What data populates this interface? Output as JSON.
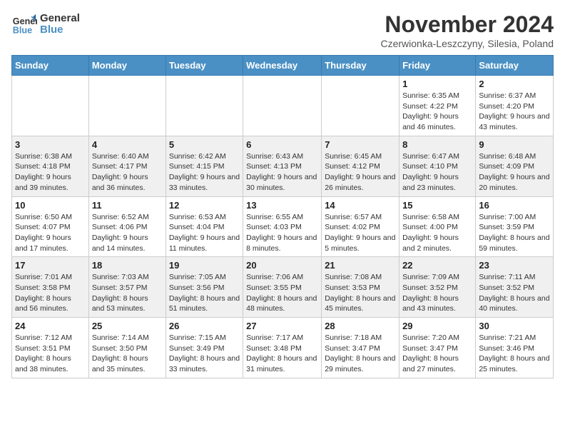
{
  "logo": {
    "line1": "General",
    "line2": "Blue"
  },
  "title": "November 2024",
  "subtitle": "Czerwionka-Leszczyny, Silesia, Poland",
  "days_of_week": [
    "Sunday",
    "Monday",
    "Tuesday",
    "Wednesday",
    "Thursday",
    "Friday",
    "Saturday"
  ],
  "weeks": [
    [
      {
        "day": "",
        "info": ""
      },
      {
        "day": "",
        "info": ""
      },
      {
        "day": "",
        "info": ""
      },
      {
        "day": "",
        "info": ""
      },
      {
        "day": "",
        "info": ""
      },
      {
        "day": "1",
        "info": "Sunrise: 6:35 AM\nSunset: 4:22 PM\nDaylight: 9 hours and 46 minutes."
      },
      {
        "day": "2",
        "info": "Sunrise: 6:37 AM\nSunset: 4:20 PM\nDaylight: 9 hours and 43 minutes."
      }
    ],
    [
      {
        "day": "3",
        "info": "Sunrise: 6:38 AM\nSunset: 4:18 PM\nDaylight: 9 hours and 39 minutes."
      },
      {
        "day": "4",
        "info": "Sunrise: 6:40 AM\nSunset: 4:17 PM\nDaylight: 9 hours and 36 minutes."
      },
      {
        "day": "5",
        "info": "Sunrise: 6:42 AM\nSunset: 4:15 PM\nDaylight: 9 hours and 33 minutes."
      },
      {
        "day": "6",
        "info": "Sunrise: 6:43 AM\nSunset: 4:13 PM\nDaylight: 9 hours and 30 minutes."
      },
      {
        "day": "7",
        "info": "Sunrise: 6:45 AM\nSunset: 4:12 PM\nDaylight: 9 hours and 26 minutes."
      },
      {
        "day": "8",
        "info": "Sunrise: 6:47 AM\nSunset: 4:10 PM\nDaylight: 9 hours and 23 minutes."
      },
      {
        "day": "9",
        "info": "Sunrise: 6:48 AM\nSunset: 4:09 PM\nDaylight: 9 hours and 20 minutes."
      }
    ],
    [
      {
        "day": "10",
        "info": "Sunrise: 6:50 AM\nSunset: 4:07 PM\nDaylight: 9 hours and 17 minutes."
      },
      {
        "day": "11",
        "info": "Sunrise: 6:52 AM\nSunset: 4:06 PM\nDaylight: 9 hours and 14 minutes."
      },
      {
        "day": "12",
        "info": "Sunrise: 6:53 AM\nSunset: 4:04 PM\nDaylight: 9 hours and 11 minutes."
      },
      {
        "day": "13",
        "info": "Sunrise: 6:55 AM\nSunset: 4:03 PM\nDaylight: 9 hours and 8 minutes."
      },
      {
        "day": "14",
        "info": "Sunrise: 6:57 AM\nSunset: 4:02 PM\nDaylight: 9 hours and 5 minutes."
      },
      {
        "day": "15",
        "info": "Sunrise: 6:58 AM\nSunset: 4:00 PM\nDaylight: 9 hours and 2 minutes."
      },
      {
        "day": "16",
        "info": "Sunrise: 7:00 AM\nSunset: 3:59 PM\nDaylight: 8 hours and 59 minutes."
      }
    ],
    [
      {
        "day": "17",
        "info": "Sunrise: 7:01 AM\nSunset: 3:58 PM\nDaylight: 8 hours and 56 minutes."
      },
      {
        "day": "18",
        "info": "Sunrise: 7:03 AM\nSunset: 3:57 PM\nDaylight: 8 hours and 53 minutes."
      },
      {
        "day": "19",
        "info": "Sunrise: 7:05 AM\nSunset: 3:56 PM\nDaylight: 8 hours and 51 minutes."
      },
      {
        "day": "20",
        "info": "Sunrise: 7:06 AM\nSunset: 3:55 PM\nDaylight: 8 hours and 48 minutes."
      },
      {
        "day": "21",
        "info": "Sunrise: 7:08 AM\nSunset: 3:53 PM\nDaylight: 8 hours and 45 minutes."
      },
      {
        "day": "22",
        "info": "Sunrise: 7:09 AM\nSunset: 3:52 PM\nDaylight: 8 hours and 43 minutes."
      },
      {
        "day": "23",
        "info": "Sunrise: 7:11 AM\nSunset: 3:52 PM\nDaylight: 8 hours and 40 minutes."
      }
    ],
    [
      {
        "day": "24",
        "info": "Sunrise: 7:12 AM\nSunset: 3:51 PM\nDaylight: 8 hours and 38 minutes."
      },
      {
        "day": "25",
        "info": "Sunrise: 7:14 AM\nSunset: 3:50 PM\nDaylight: 8 hours and 35 minutes."
      },
      {
        "day": "26",
        "info": "Sunrise: 7:15 AM\nSunset: 3:49 PM\nDaylight: 8 hours and 33 minutes."
      },
      {
        "day": "27",
        "info": "Sunrise: 7:17 AM\nSunset: 3:48 PM\nDaylight: 8 hours and 31 minutes."
      },
      {
        "day": "28",
        "info": "Sunrise: 7:18 AM\nSunset: 3:47 PM\nDaylight: 8 hours and 29 minutes."
      },
      {
        "day": "29",
        "info": "Sunrise: 7:20 AM\nSunset: 3:47 PM\nDaylight: 8 hours and 27 minutes."
      },
      {
        "day": "30",
        "info": "Sunrise: 7:21 AM\nSunset: 3:46 PM\nDaylight: 8 hours and 25 minutes."
      }
    ]
  ]
}
